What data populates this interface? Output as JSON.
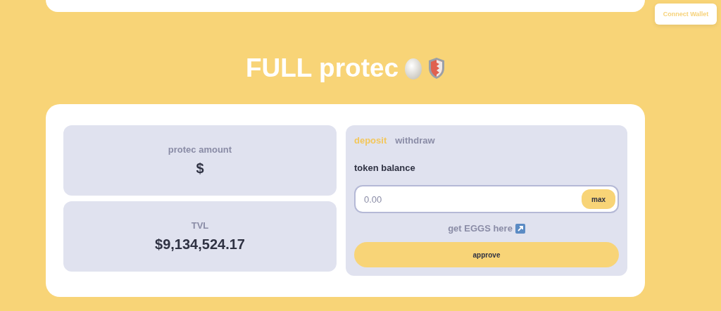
{
  "header": {
    "connect_button": "Connect Wallet"
  },
  "title": "FULL protec",
  "stats": [
    {
      "label": "protec amount",
      "value": "$"
    },
    {
      "label": "TVL",
      "value": "$9,134,524.17"
    }
  ],
  "panel": {
    "tabs": [
      {
        "label": "deposit",
        "selected": true
      },
      {
        "label": "withdraw",
        "selected": false
      }
    ],
    "balance_label": "token balance",
    "amount_field": {
      "placeholder": "0.00"
    },
    "max_button": "max",
    "link": "get EGGS here",
    "approve_button": "approve"
  }
}
